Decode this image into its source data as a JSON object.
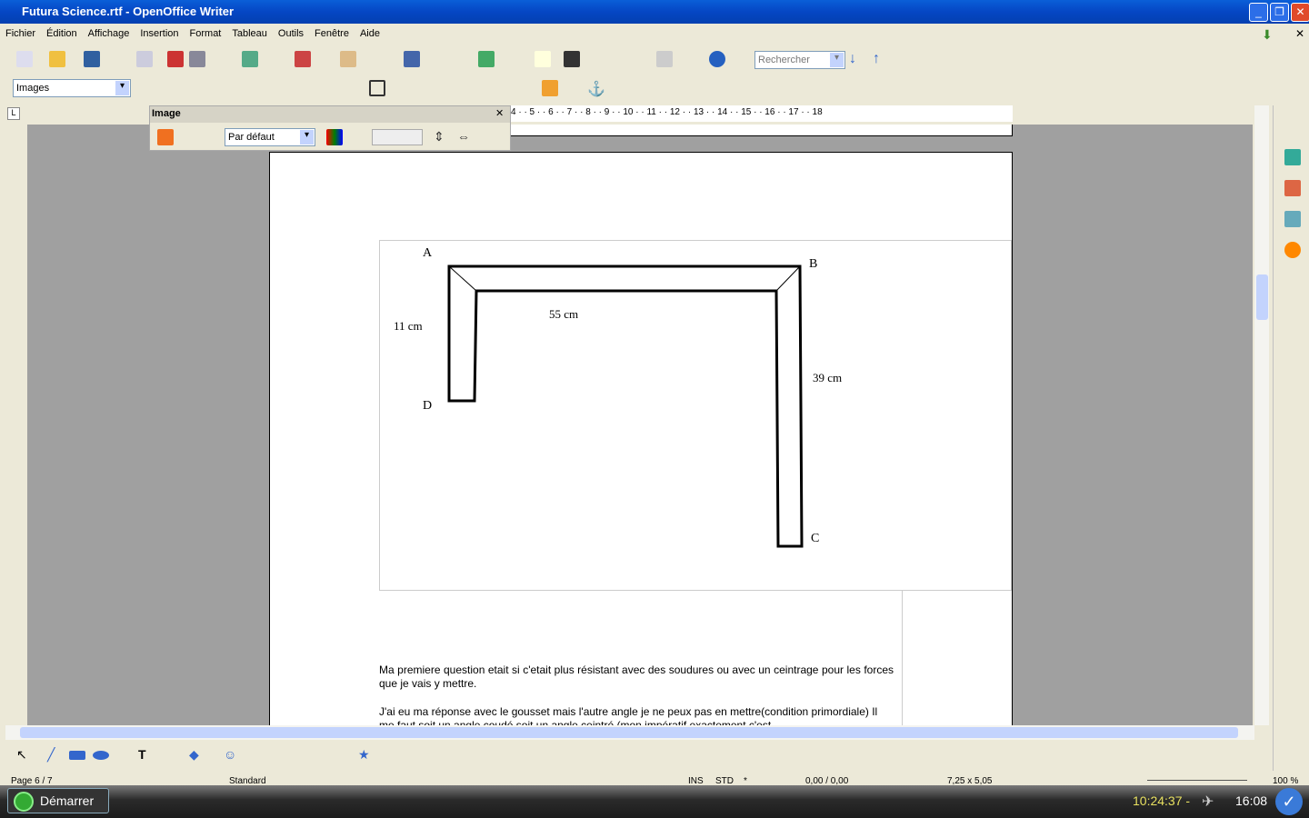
{
  "window": {
    "title": "Futura Science.rtf - OpenOffice Writer"
  },
  "menu": [
    "Fichier",
    "Édition",
    "Affichage",
    "Insertion",
    "Format",
    "Tableau",
    "Outils",
    "Fenêtre",
    "Aide"
  ],
  "toolbar": {
    "search_placeholder": "Rechercher",
    "style_value": "Images"
  },
  "image_toolbar": {
    "title": "Image",
    "mode_value": "Par défaut"
  },
  "ruler": "4 · · 5 · · 6 · · 7 · · 8 · · 9 · · 10 · · 11 · · 12 · · 13 · · 14 · · 15 · · 16 · · 17 · · 18",
  "drawing": {
    "A": "A",
    "B": "B",
    "C": "C",
    "D": "D",
    "dim1": "11 cm",
    "dim2": "55 cm",
    "dim3": "39 cm"
  },
  "body": {
    "p1": "Ma premiere question etait si c'etait plus résistant avec des soudures ou avec un ceintrage pour les forces que je vais y mettre.",
    "p2": "J'ai eu ma réponse avec le gousset mais l'autre angle je ne peux pas en mettre(condition primordiale) Il me faut soit un angle coudé soit un angle ceintré (mon impératif exactement c'est"
  },
  "status": {
    "page": "Page 6 / 7",
    "style": "Standard",
    "ins": "INS",
    "std": "STD",
    "mod": "*",
    "pos": "0,00 / 0,00",
    "size": "7,25 x 5,05",
    "zoom": "100 %"
  },
  "taskbar": {
    "start": "Démarrer",
    "timer": "10:24:37 -",
    "clock": "16:08"
  }
}
